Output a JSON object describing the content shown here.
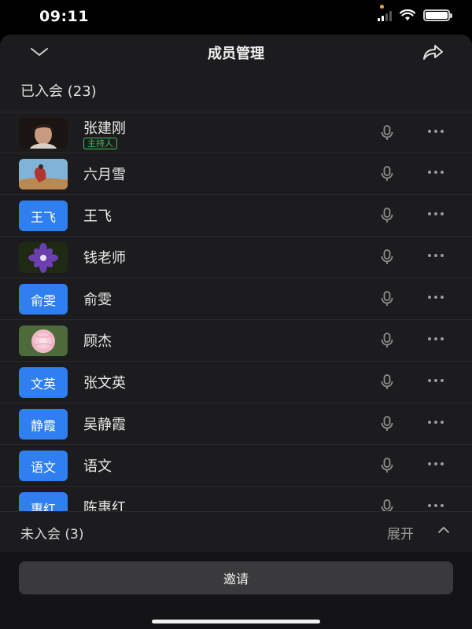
{
  "status_bar": {
    "time": "09:11"
  },
  "header": {
    "title": "成员管理",
    "collapse_icon": "chevron-down-icon",
    "share_icon": "share-arrow-icon"
  },
  "joined_section": {
    "title": "已入会 (23)"
  },
  "members": [
    {
      "name": "张建刚",
      "avatar_type": "photo",
      "avatar_icon": "photo-portrait",
      "badge": "主持人"
    },
    {
      "name": "六月雪",
      "avatar_type": "photo",
      "avatar_icon": "photo-desert"
    },
    {
      "name": "王飞",
      "avatar_type": "text",
      "avatar_text": "王飞"
    },
    {
      "name": "钱老师",
      "avatar_type": "photo",
      "avatar_icon": "photo-purple-flower"
    },
    {
      "name": "俞雯",
      "avatar_type": "text",
      "avatar_text": "俞雯"
    },
    {
      "name": "顾杰",
      "avatar_type": "photo",
      "avatar_icon": "photo-pink-flower"
    },
    {
      "name": "张文英",
      "avatar_type": "text",
      "avatar_text": "文英"
    },
    {
      "name": "吴静霞",
      "avatar_type": "text",
      "avatar_text": "静霞"
    },
    {
      "name": "语文",
      "avatar_type": "text",
      "avatar_text": "语文"
    },
    {
      "name": "陈惠红",
      "avatar_type": "text",
      "avatar_text": "惠红"
    }
  ],
  "not_joined_section": {
    "title": "未入会 (3)",
    "expand_label": "展开",
    "expand_icon": "chevron-up-icon"
  },
  "invite": {
    "label": "邀请"
  },
  "colors": {
    "avatar_blue": "#2f7ff0",
    "host_green": "#3fbf5a",
    "sheet_bg": "#1c1c1e"
  }
}
